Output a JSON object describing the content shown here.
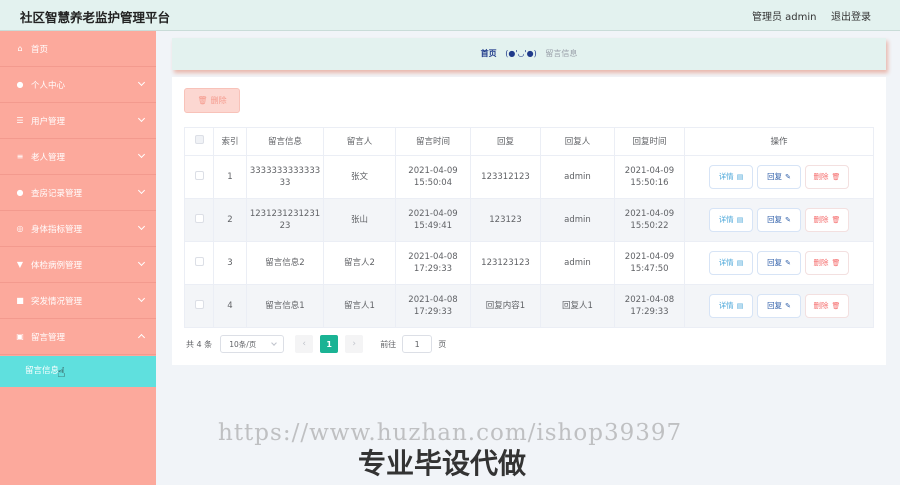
{
  "app": {
    "title": "社区智慧养老监护管理平台",
    "user": "管理员 admin",
    "logout": "退出登录"
  },
  "sidebar": {
    "items": [
      {
        "label": "首页",
        "icon": "home-icon",
        "glyph": "⌂"
      },
      {
        "label": "个人中心",
        "icon": "user-icon",
        "glyph": "●"
      },
      {
        "label": "用户管理",
        "icon": "sliders-icon",
        "glyph": "☰"
      },
      {
        "label": "老人管理",
        "icon": "list-icon",
        "glyph": "≡"
      },
      {
        "label": "查房记录管理",
        "icon": "person-icon",
        "glyph": "●"
      },
      {
        "label": "身体指标管理",
        "icon": "globe-icon",
        "glyph": "◎"
      },
      {
        "label": "体检病例管理",
        "icon": "download-icon",
        "glyph": "▼"
      },
      {
        "label": "突发情况管理",
        "icon": "briefcase-icon",
        "glyph": "■"
      },
      {
        "label": "留言管理",
        "icon": "clipboard-icon",
        "glyph": "▣"
      }
    ],
    "active_sub": "留言信息"
  },
  "breadcrumb": {
    "home": "首页",
    "face": "(●'◡'●)",
    "current": "留言信息"
  },
  "toolbar": {
    "delete_label": "删除"
  },
  "table": {
    "headers": [
      "",
      "索引",
      "留言信息",
      "留言人",
      "留言时间",
      "回复",
      "回复人",
      "回复时间",
      "操作"
    ],
    "rows": [
      {
        "index": "1",
        "message": "333333333333333",
        "author": "张文",
        "time": "2021-04-09 15:50:04",
        "reply": "123312123",
        "replier": "admin",
        "reply_time": "2021-04-09 15:50:16"
      },
      {
        "index": "2",
        "message": "123123123123123",
        "author": "张山",
        "time": "2021-04-09 15:49:41",
        "reply": "123123",
        "replier": "admin",
        "reply_time": "2021-04-09 15:50:22"
      },
      {
        "index": "3",
        "message": "留言信息2",
        "author": "留言人2",
        "time": "2021-04-08 17:29:33",
        "reply": "123123123",
        "replier": "admin",
        "reply_time": "2021-04-09 15:47:50"
      },
      {
        "index": "4",
        "message": "留言信息1",
        "author": "留言人1",
        "time": "2021-04-08 17:29:33",
        "reply": "回复内容1",
        "replier": "回复人1",
        "reply_time": "2021-04-08 17:29:33"
      }
    ],
    "actions": {
      "detail": "详情",
      "reply": "回复",
      "delete": "删除"
    }
  },
  "pagination": {
    "total": "共 4 条",
    "page_size": "10条/页",
    "current_page": "1",
    "goto_prefix": "前往",
    "goto_value": "1",
    "goto_suffix": "页"
  },
  "watermark": {
    "url": "https://www.huzhan.com/ishop39397",
    "slogan": "专业毕设代做"
  },
  "colors": {
    "sidebar": "#fca99c",
    "active_sub": "#5fe0de",
    "page_active": "#1ab394",
    "topbar": "#e3f2ef"
  }
}
